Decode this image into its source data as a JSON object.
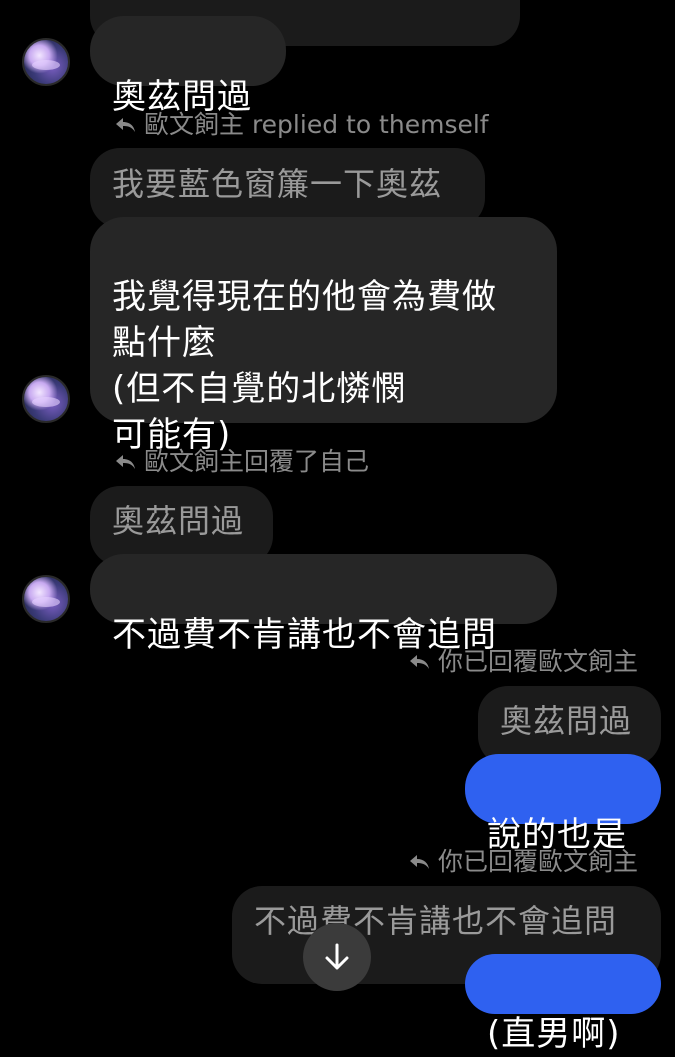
{
  "thread": {
    "m1": {
      "text": "奧茲問過"
    },
    "r1": {
      "note": "歐文飼主 replied to themself",
      "quote": "我要藍色窗簾一下奧茲",
      "text": "我覺得現在的他會為費做\n點什麼\n(但不自覺的北憐憫\n可能有)"
    },
    "r2": {
      "note": "歐文飼主回覆了自己",
      "quote": "奧茲問過",
      "text": "不過費不肯講也不會追問"
    },
    "r3": {
      "note": "你已回覆歐文飼主",
      "quote": "奧茲問過",
      "text": "說的也是"
    },
    "r4": {
      "note": "你已回覆歐文飼主",
      "quote": "不過費不肯講也不會追問",
      "text": "(直男啊)"
    }
  },
  "colors": {
    "sent_bubble": "#2f61f0",
    "received_bubble": "#262626",
    "quoted_bubble": "#1b1b1b"
  },
  "icons": {
    "reply": "reply-arrow-icon",
    "scroll_down": "arrow-down-icon"
  }
}
